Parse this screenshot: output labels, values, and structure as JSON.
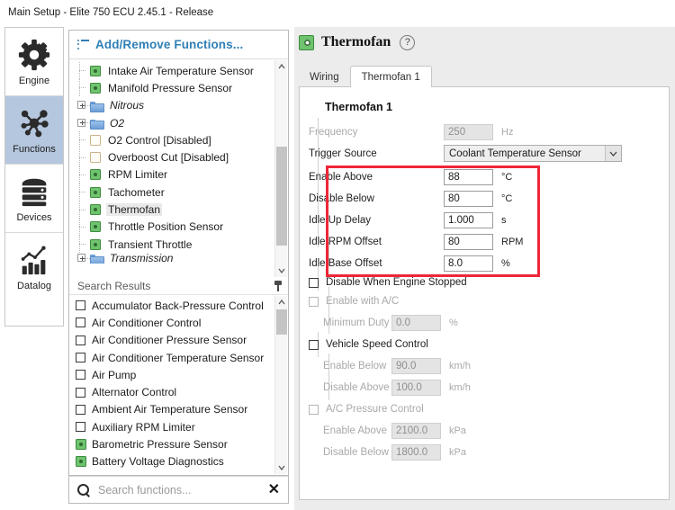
{
  "window": {
    "title": "Main Setup - Elite 750 ECU 2.45.1 - Release"
  },
  "rail": {
    "items": [
      {
        "label": "Engine",
        "icon": "gear-icon",
        "selected": false
      },
      {
        "label": "Functions",
        "icon": "network-icon",
        "selected": true
      },
      {
        "label": "Devices",
        "icon": "server-icon",
        "selected": false
      },
      {
        "label": "Datalog",
        "icon": "bar-chart-icon",
        "selected": false
      }
    ]
  },
  "functions_panel": {
    "header_label": "Add/Remove Functions...",
    "header_icon": "list-icon",
    "tree": [
      {
        "label": "Intake Air Temperature Sensor",
        "kind": "leaf",
        "state": "enabled"
      },
      {
        "label": "Manifold Pressure Sensor",
        "kind": "leaf",
        "state": "enabled"
      },
      {
        "label": "Nitrous",
        "kind": "folder",
        "state": "collapsed"
      },
      {
        "label": "O2",
        "kind": "folder",
        "state": "collapsed"
      },
      {
        "label": "O2 Control [Disabled]",
        "kind": "leaf",
        "state": "disabled"
      },
      {
        "label": "Overboost Cut [Disabled]",
        "kind": "leaf",
        "state": "disabled"
      },
      {
        "label": "RPM Limiter",
        "kind": "leaf",
        "state": "enabled"
      },
      {
        "label": "Tachometer",
        "kind": "leaf",
        "state": "enabled"
      },
      {
        "label": "Thermofan",
        "kind": "leaf",
        "state": "enabled",
        "selected": true
      },
      {
        "label": "Throttle Position Sensor",
        "kind": "leaf",
        "state": "enabled"
      },
      {
        "label": "Transient Throttle",
        "kind": "leaf",
        "state": "enabled"
      },
      {
        "label": "Transmission",
        "kind": "folder",
        "state": "collapsed"
      }
    ]
  },
  "search_results": {
    "header_label": "Search Results",
    "pin_icon": "pin-icon",
    "items": [
      {
        "label": "Accumulator Back-Pressure Control",
        "state": "unchecked"
      },
      {
        "label": "Air Conditioner Control",
        "state": "unchecked"
      },
      {
        "label": "Air Conditioner Pressure Sensor",
        "state": "unchecked"
      },
      {
        "label": "Air Conditioner Temperature Sensor",
        "state": "unchecked"
      },
      {
        "label": "Air Pump",
        "state": "unchecked"
      },
      {
        "label": "Alternator Control",
        "state": "unchecked"
      },
      {
        "label": "Ambient Air Temperature Sensor",
        "state": "unchecked"
      },
      {
        "label": "Auxiliary RPM Limiter",
        "state": "unchecked"
      },
      {
        "label": "Barometric Pressure Sensor",
        "state": "enabled"
      },
      {
        "label": "Battery Voltage Diagnostics",
        "state": "enabled"
      }
    ]
  },
  "search_box": {
    "placeholder": "Search functions...",
    "value": "",
    "search_icon": "search-icon",
    "clear_icon": "close-icon"
  },
  "page": {
    "title": "Thermofan",
    "title_icon": "thermofan-icon",
    "help_label": "?",
    "tabs": [
      {
        "label": "Wiring",
        "active": false
      },
      {
        "label": "Thermofan 1",
        "active": true
      }
    ],
    "section_title": "Thermofan 1",
    "fields": [
      {
        "label": "Frequency",
        "value": "250",
        "unit": "Hz",
        "readonly": true
      },
      {
        "label": "Enable Above",
        "value": "88",
        "unit": "°C",
        "readonly": false
      },
      {
        "label": "Disable Below",
        "value": "80",
        "unit": "°C",
        "readonly": false
      },
      {
        "label": "Idle Up Delay",
        "value": "1.000",
        "unit": "s",
        "readonly": false
      },
      {
        "label": "Idle RPM Offset",
        "value": "80",
        "unit": "RPM",
        "readonly": false
      },
      {
        "label": "Idle Base Offset",
        "value": "8.0",
        "unit": "%",
        "readonly": false
      }
    ],
    "trigger_source": {
      "label": "Trigger Source",
      "selected": "Coolant Temperature Sensor",
      "arrow_icon": "chevron-down-icon"
    },
    "checkboxes": [
      {
        "label": "Disable When Engine Stopped",
        "checked": false,
        "dim": false
      },
      {
        "label": "Enable with A/C",
        "checked": false,
        "dim": true
      },
      {
        "label": "Vehicle Speed Control",
        "checked": false,
        "dim": false
      },
      {
        "label": "A/C Pressure Control",
        "checked": false,
        "dim": true
      }
    ],
    "sub_fields": [
      {
        "label": "Minimum Duty",
        "value": "0.0",
        "unit": "%"
      },
      {
        "label": "Enable Below",
        "value": "90.0",
        "unit": "km/h"
      },
      {
        "label": "Disable Above",
        "value": "100.0",
        "unit": "km/h"
      },
      {
        "label": "Enable Above",
        "value": "2100.0",
        "unit": "kPa"
      },
      {
        "label": "Disable Below",
        "value": "1800.0",
        "unit": "kPa"
      }
    ],
    "annotation": {
      "color": "#ee2738"
    }
  }
}
